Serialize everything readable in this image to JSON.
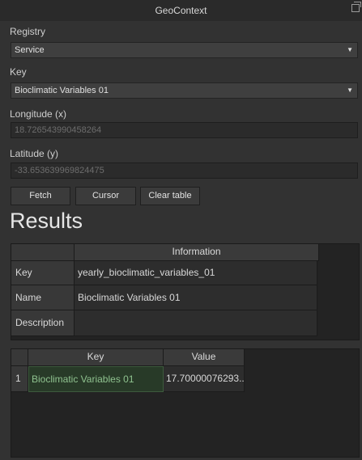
{
  "window": {
    "title": "GeoContext"
  },
  "registry": {
    "label": "Registry",
    "value": "Service"
  },
  "key": {
    "label": "Key",
    "value": "Bioclimatic Variables 01"
  },
  "longitude": {
    "label": "Longitude (x)",
    "placeholder": "18.726543990458264"
  },
  "latitude": {
    "label": "Latitude (y)",
    "placeholder": "-33.653639969824475"
  },
  "buttons": {
    "fetch": "Fetch",
    "cursor": "Cursor",
    "clear": "Clear table"
  },
  "results": {
    "title": "Results"
  },
  "info_table": {
    "header": "Information",
    "rows": [
      {
        "label": "Key",
        "value": "yearly_bioclimatic_variables_01"
      },
      {
        "label": "Name",
        "value": "Bioclimatic Variables 01"
      },
      {
        "label": "Description",
        "value": ""
      }
    ]
  },
  "values_table": {
    "columns": [
      "Key",
      "Value"
    ],
    "rows": [
      {
        "index": "1",
        "key": "Bioclimatic Variables 01",
        "value": "17.70000076293..."
      }
    ]
  },
  "colors": {
    "background": "#323232",
    "selected_text": "#8fc28f",
    "selected_bg": "#283a28"
  },
  "icons": {
    "undock": "undock-icon",
    "dropdown": "chevron-down-icon"
  }
}
